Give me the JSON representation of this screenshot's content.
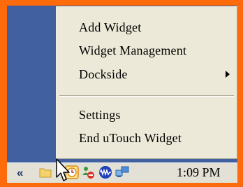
{
  "context_menu": {
    "items": [
      {
        "label": "Add Widget"
      },
      {
        "label": "Widget Management"
      },
      {
        "label": "Dockside",
        "has_submenu": true
      },
      {
        "label": "Settings"
      },
      {
        "label": "End uTouch Widget"
      }
    ]
  },
  "taskbar": {
    "chevron": "«",
    "tray_icons": [
      "folder-icon",
      "clock-icon",
      "network-users-icon",
      "audio-wave-icon",
      "monitor-network-icon"
    ],
    "clock": "1:09 PM"
  },
  "colors": {
    "frame": "#ff6b0a",
    "desktop": "#41609f",
    "menu_bg": "#ece9d8",
    "taskbar_bg": "#e3e1d6"
  }
}
